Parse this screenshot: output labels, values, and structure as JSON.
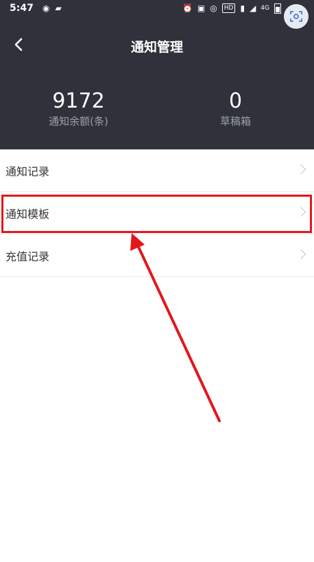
{
  "status_bar": {
    "time": "5:47",
    "left_icons": [
      "record-icon",
      "cast-icon"
    ],
    "right_icons": [
      "alarm-icon",
      "app-icon",
      "nfc-icon",
      "hd-badge",
      "vibrate-icon",
      "signal-icon",
      "data-icon",
      "battery-icon"
    ],
    "hd_label": "HD",
    "data_label": "4G"
  },
  "nav": {
    "title": "通知管理",
    "back_icon": "chevron-left-icon"
  },
  "stats": {
    "balance_value": "9172",
    "balance_label": "通知余额(条)",
    "draft_value": "0",
    "draft_label": "草稿箱"
  },
  "menu": {
    "items": [
      {
        "label": "通知记录",
        "icon": "chevron-right-icon"
      },
      {
        "label": "通知模板",
        "icon": "chevron-right-icon"
      },
      {
        "label": "充值记录",
        "icon": "chevron-right-icon"
      }
    ]
  },
  "annotation": {
    "color": "#e3161c",
    "highlighted_item": "通知模板"
  },
  "colors": {
    "header_bg": "#2f323a",
    "accent_red": "#e3161c",
    "stat_label": "#9da1aa"
  }
}
